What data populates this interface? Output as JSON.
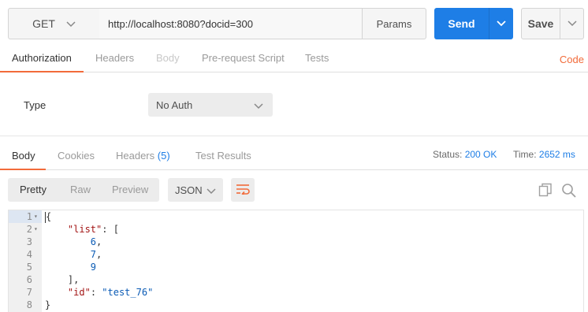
{
  "request": {
    "method": "GET",
    "url": "http://localhost:8080?docid=300",
    "params_label": "Params",
    "send_label": "Send",
    "save_label": "Save"
  },
  "request_tabs": {
    "authorization": "Authorization",
    "headers": "Headers",
    "body": "Body",
    "prerequest": "Pre-request Script",
    "tests": "Tests",
    "code": "Code"
  },
  "auth": {
    "type_label": "Type",
    "type_value": "No Auth"
  },
  "response_tabs": {
    "body": "Body",
    "cookies": "Cookies",
    "headers": "Headers",
    "headers_count": "(5)",
    "test_results": "Test Results"
  },
  "response_status": {
    "status_label": "Status:",
    "status_value": "200 OK",
    "time_label": "Time:",
    "time_value": "2652 ms"
  },
  "response_view": {
    "pretty": "Pretty",
    "raw": "Raw",
    "preview": "Preview",
    "format": "JSON"
  },
  "editor": {
    "lines": [
      {
        "num": "1",
        "fold": true,
        "text": "{"
      },
      {
        "num": "2",
        "fold": true,
        "key": "\"list\"",
        "rest": ": ["
      },
      {
        "num": "3",
        "fold": false,
        "num_val": "6",
        "rest": ","
      },
      {
        "num": "4",
        "fold": false,
        "num_val": "7",
        "rest": ","
      },
      {
        "num": "5",
        "fold": false,
        "num_val": "9",
        "rest": ""
      },
      {
        "num": "6",
        "fold": false,
        "text": "    ],"
      },
      {
        "num": "7",
        "fold": false,
        "key": "\"id\"",
        "rest": ": ",
        "str_val": "\"test_76\""
      },
      {
        "num": "8",
        "fold": false,
        "text": "}"
      }
    ]
  },
  "colors": {
    "accent": "#f26b3a",
    "send_blue": "#1e7ee6"
  }
}
